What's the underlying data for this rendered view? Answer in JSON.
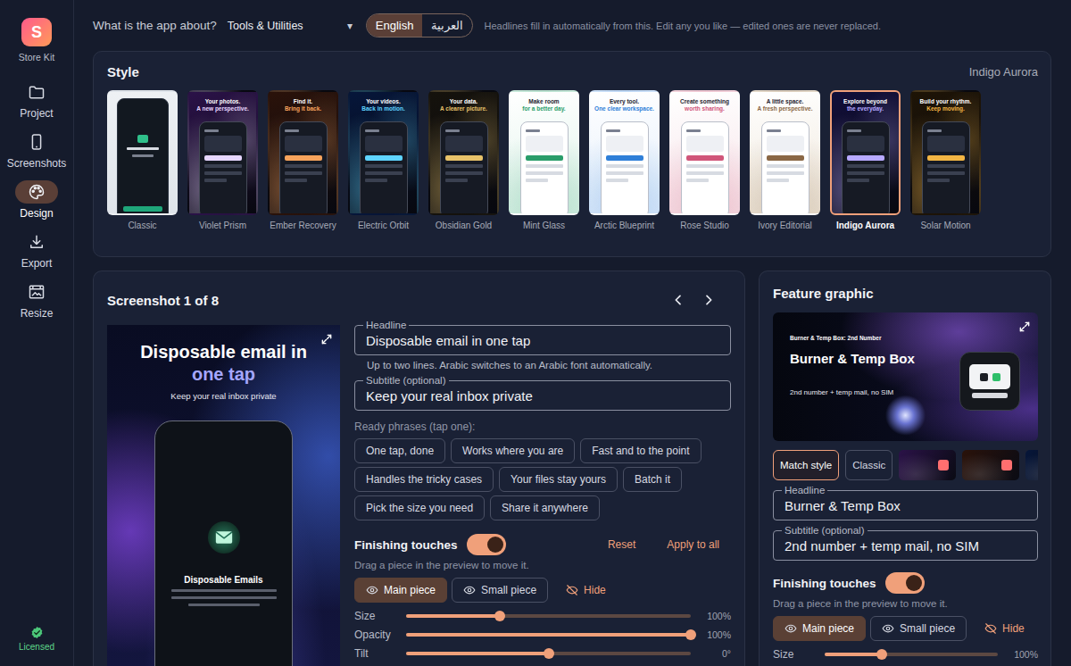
{
  "sidebar": {
    "logo": "S",
    "app_name": "Store Kit",
    "items": [
      {
        "label": "Project",
        "kind": "folder",
        "selected": false
      },
      {
        "label": "Screenshots",
        "kind": "phone",
        "selected": false
      },
      {
        "label": "Design",
        "kind": "palette",
        "selected": true
      },
      {
        "label": "Export",
        "kind": "download",
        "selected": false
      },
      {
        "label": "Resize",
        "kind": "resize",
        "selected": false
      }
    ],
    "license": "Licensed"
  },
  "topbar": {
    "question": "What is the app about?",
    "category": "Tools & Utilities",
    "caret": "▾",
    "languages": [
      {
        "label": "English",
        "selected": true
      },
      {
        "label": "العربية",
        "selected": false
      }
    ],
    "hint": "Headlines fill in automatically from this. Edit any you like — edited ones are never replaced."
  },
  "style": {
    "title": "Style",
    "current": "Indigo Aurora",
    "themes": [
      {
        "name": "Classic",
        "kind": "classic",
        "selected": false,
        "color": "#eef1f4",
        "accent": "#1fa67a"
      },
      {
        "name": "Violet Prism",
        "kind": "dark",
        "selected": false,
        "color": "#2b1248",
        "accent": "#e6d6ff",
        "line1": "Your photos.",
        "line2": "A new perspective."
      },
      {
        "name": "Ember Recovery",
        "kind": "dark",
        "selected": false,
        "color": "#2a120a",
        "accent": "#f7a35c",
        "line1": "Find it.",
        "line2": "Bring it back."
      },
      {
        "name": "Electric Orbit",
        "kind": "dark",
        "selected": false,
        "color": "#06163a",
        "accent": "#5fd4ff",
        "line1": "Your videos.",
        "line2": "Back in motion."
      },
      {
        "name": "Obsidian Gold",
        "kind": "dark",
        "selected": false,
        "color": "#15120c",
        "accent": "#e7c26a",
        "line1": "Your data.",
        "line2": "A clearer picture."
      },
      {
        "name": "Mint Glass",
        "kind": "light",
        "selected": false,
        "color": "#dff3ea",
        "accent": "#2a9d6a",
        "line1": "Make room",
        "line2": "for a better day."
      },
      {
        "name": "Arctic Blueprint",
        "kind": "light",
        "selected": false,
        "color": "#e3eefb",
        "accent": "#2f7fd8",
        "line1": "Every tool.",
        "line2": "One clear workspace."
      },
      {
        "name": "Rose Studio",
        "kind": "light",
        "selected": false,
        "color": "#f6e3e8",
        "accent": "#d0567a",
        "line1": "Create something",
        "line2": "worth sharing."
      },
      {
        "name": "Ivory Editorial",
        "kind": "light",
        "selected": false,
        "color": "#efe7da",
        "accent": "#8a6745",
        "line1": "A little space.",
        "line2": "A fresh perspective."
      },
      {
        "name": "Indigo Aurora",
        "kind": "dark",
        "selected": true,
        "color": "#120f3a",
        "accent": "#b7a9ff",
        "line1": "Explore beyond",
        "line2": "the everyday."
      },
      {
        "name": "Solar Motion",
        "kind": "dark",
        "selected": false,
        "color": "#1e1406",
        "accent": "#f2b544",
        "line1": "Build your rhythm.",
        "line2": "Keep moving."
      }
    ]
  },
  "screenshot": {
    "title": "Screenshot 1 of 8",
    "preview": {
      "headline_main": "Disposable email in",
      "headline_accent": "one tap",
      "subtitle": "Keep your real inbox private",
      "screen_title": "Disposable Emails"
    },
    "headline": {
      "label": "Headline",
      "value": "Disposable email in one tap"
    },
    "headline_hint": "Up to two lines. Arabic switches to an Arabic font automatically.",
    "subtitle": {
      "label": "Subtitle (optional)",
      "value": "Keep your real inbox private"
    },
    "phrases_label": "Ready phrases (tap one):",
    "phrases": [
      "One tap, done",
      "Works where you are",
      "Fast and to the point",
      "Handles the tricky cases",
      "Your files stay yours",
      "Batch it",
      "Pick the size you need",
      "Share it anywhere"
    ],
    "finishing": {
      "label": "Finishing touches",
      "on": true,
      "reset": "Reset",
      "apply_all": "Apply to all",
      "hint": "Drag a piece in the preview to move it.",
      "pieces": [
        {
          "label": "Main piece",
          "kind": "eye",
          "selected": true
        },
        {
          "label": "Small piece",
          "kind": "eye",
          "selected": false
        },
        {
          "label": "Hide",
          "kind": "hide",
          "selected": false
        }
      ],
      "sliders": [
        {
          "label": "Size",
          "level": 0.33,
          "reading": "100%"
        },
        {
          "label": "Opacity",
          "level": 1.0,
          "reading": "100%"
        },
        {
          "label": "Tilt",
          "level": 0.5,
          "reading": "0°"
        }
      ]
    }
  },
  "feature_graphic": {
    "title": "Feature graphic",
    "preview": {
      "eyebrow": "Burner & Temp Box: 2nd Number",
      "headline": "Burner & Temp Box",
      "subtitle": "2nd number + temp mail, no SIM"
    },
    "styles": [
      {
        "label": "Match style",
        "selected": true
      },
      {
        "label": "Classic",
        "selected": false
      }
    ],
    "thumbs": [
      {
        "color": "#2b1248"
      },
      {
        "color": "#2a120a"
      },
      {
        "color": "#06163a"
      }
    ],
    "headline": {
      "label": "Headline",
      "value": "Burner & Temp Box"
    },
    "subtitle": {
      "label": "Subtitle (optional)",
      "value": "2nd number + temp mail, no SIM"
    },
    "finishing": {
      "label": "Finishing touches",
      "on": true,
      "hint": "Drag a piece in the preview to move it.",
      "pieces": [
        {
          "label": "Main piece",
          "kind": "eye",
          "selected": true
        },
        {
          "label": "Small piece",
          "kind": "eye",
          "selected": false
        },
        {
          "label": "Hide",
          "kind": "hide",
          "selected": false
        }
      ],
      "sliders": [
        {
          "label": "Size",
          "level": 0.33,
          "reading": "100%"
        }
      ]
    }
  }
}
